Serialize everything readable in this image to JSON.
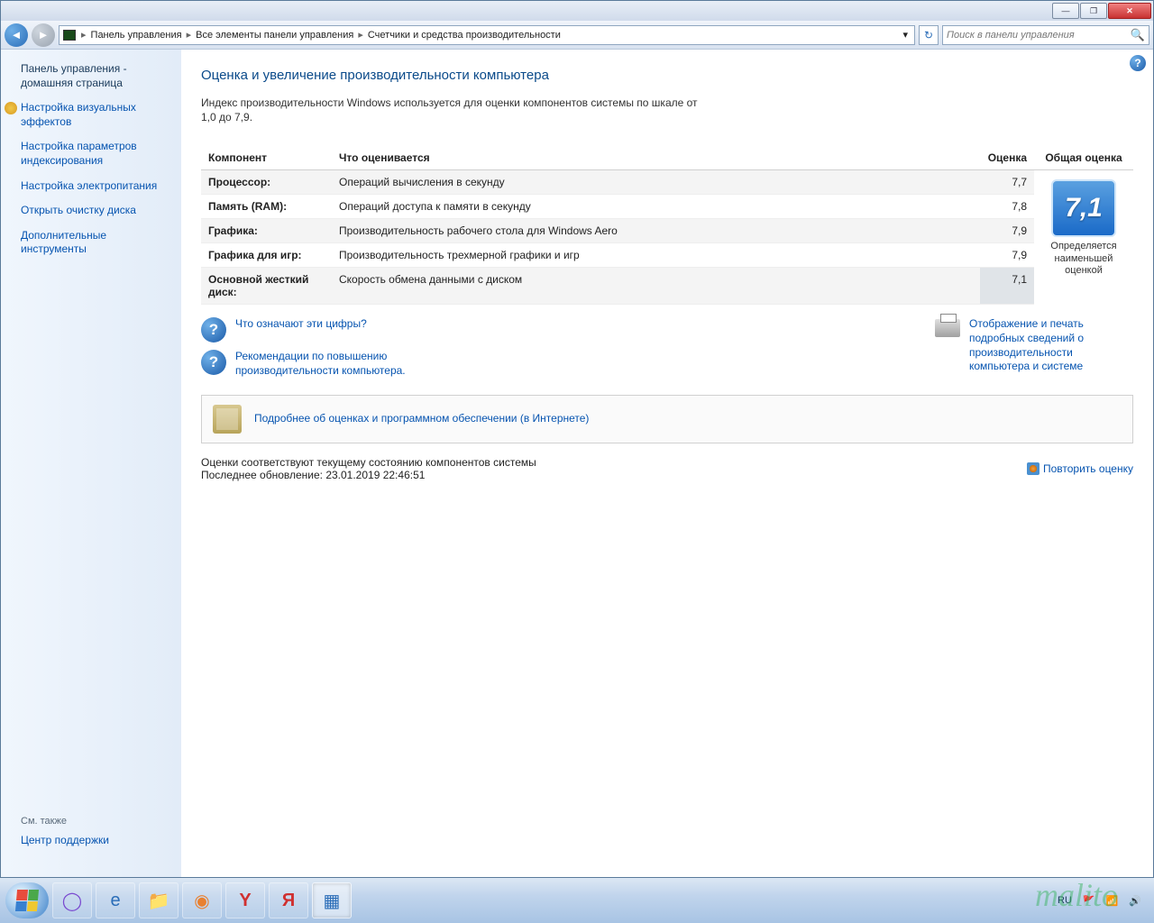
{
  "titlebar": {
    "min": "—",
    "max": "❐",
    "close": "✕"
  },
  "breadcrumb": {
    "seg1": "Панель управления",
    "seg2": "Все элементы панели управления",
    "seg3": "Счетчики и средства производительности",
    "dropdown": "▾",
    "refresh": "↻"
  },
  "search": {
    "placeholder": "Поиск в панели управления"
  },
  "sidebar": {
    "home": "Панель управления - домашняя страница",
    "l1": "Настройка визуальных эффектов",
    "l2": "Настройка параметров индексирования",
    "l3": "Настройка электропитания",
    "l4": "Открыть очистку диска",
    "l5": "Дополнительные инструменты",
    "seealso": "См. также",
    "support": "Центр поддержки"
  },
  "main": {
    "title": "Оценка и увеличение производительности компьютера",
    "intro": "Индекс производительности Windows используется для оценки компонентов системы по шкале от 1,0 до 7,9.",
    "th_comp": "Компонент",
    "th_desc": "Что оценивается",
    "th_score": "Оценка",
    "th_overall": "Общая оценка",
    "rows": [
      {
        "comp": "Процессор:",
        "desc": "Операций вычисления в секунду",
        "score": "7,7"
      },
      {
        "comp": "Память (RAM):",
        "desc": "Операций доступа к памяти в секунду",
        "score": "7,8"
      },
      {
        "comp": "Графика:",
        "desc": "Производительность рабочего стола для Windows Aero",
        "score": "7,9"
      },
      {
        "comp": "Графика для игр:",
        "desc": "Производительность трехмерной графики и игр",
        "score": "7,9"
      },
      {
        "comp": "Основной жесткий диск:",
        "desc": "Скорость обмена данными с диском",
        "score": "7,1"
      }
    ],
    "overall_score": "7,1",
    "overall_sub": "Определяется наименьшей оценкой",
    "link_what": "Что означают эти цифры?",
    "link_reco": "Рекомендации по повышению производительности компьютера.",
    "link_print": "Отображение и печать подробных сведений о производительности компьютера и системе",
    "link_online": "Подробнее об оценках и программном обеспечении (в Интернете)",
    "status1": "Оценки соответствуют текущему состоянию компонентов системы",
    "status2": "Последнее обновление: 23.01.2019 22:46:51",
    "rerun": "Повторить оценку"
  },
  "tray": {
    "lang": "RU"
  },
  "watermark": "malito"
}
